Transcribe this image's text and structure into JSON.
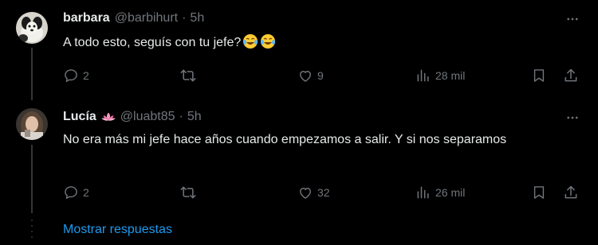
{
  "replies": [
    {
      "name": "barbara",
      "handle": "@barbihurt",
      "separator": "·",
      "time": "5h",
      "text": "A todo esto, seguís con tu jefe?",
      "emojis": [
        "face-with-tears-of-joy",
        "face-with-tears-of-joy"
      ],
      "actions": {
        "replies": "2",
        "reposts": "",
        "likes": "9",
        "views": "28 mil"
      }
    },
    {
      "name": "Lucía",
      "name_emoji": "lotus",
      "handle": "@luabt85",
      "separator": "·",
      "time": "5h",
      "text": "No era más mi jefe hace años cuando empezamos a salir. Y si nos separamos",
      "actions": {
        "replies": "2",
        "reposts": "",
        "likes": "32",
        "views": "26 mil"
      }
    }
  ],
  "show_replies_label": "Mostrar respuestas",
  "colors": {
    "background": "#000000",
    "text": "#e7e9ea",
    "muted": "#71767b",
    "link": "#1d9bf0",
    "thread_line": "#333639"
  }
}
